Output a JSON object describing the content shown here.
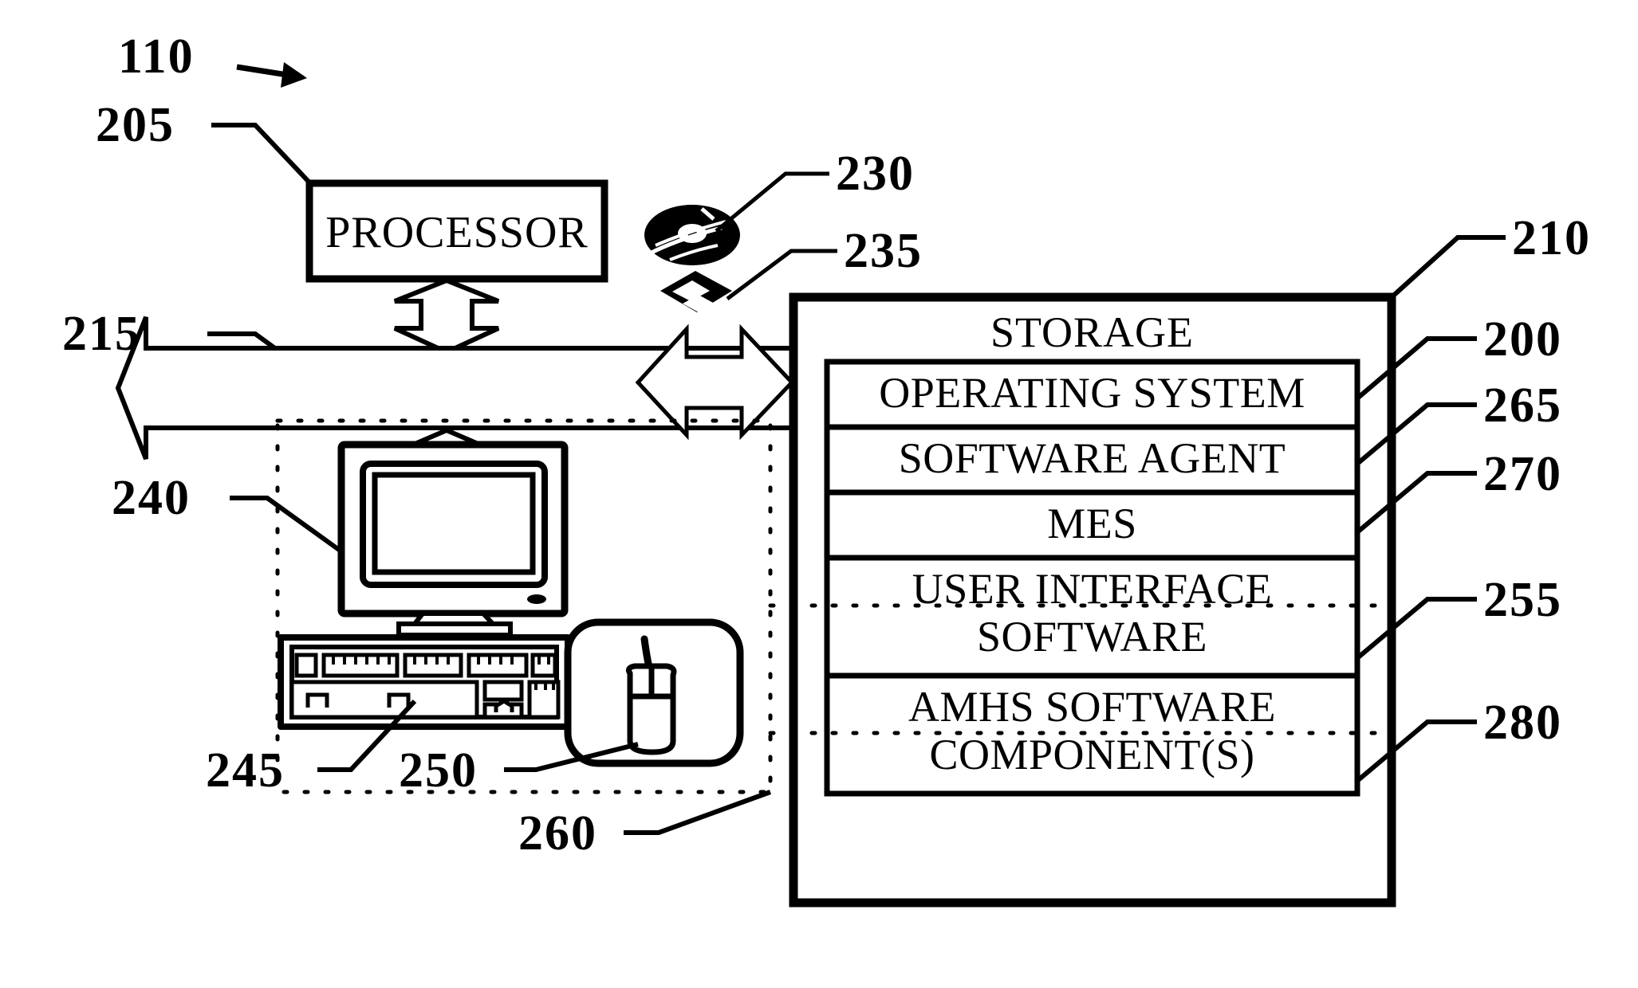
{
  "figure": {
    "title": "Computer system block diagram",
    "system_ref": "110"
  },
  "blocks": {
    "processor": {
      "label": "PROCESSOR",
      "ref": "205"
    },
    "bus": {
      "ref": "215"
    },
    "storage": {
      "label": "STORAGE",
      "ref": "210"
    },
    "monitor": {
      "ref": "240"
    },
    "keyboard": {
      "ref": "245"
    },
    "mouse": {
      "ref": "250"
    },
    "user_interface_group": {
      "ref": "260"
    },
    "optical_disc": {
      "ref": "230"
    },
    "floppy_disk": {
      "ref": "235"
    }
  },
  "storage_slots": [
    {
      "label": "OPERATING SYSTEM",
      "ref": "200"
    },
    {
      "label": "SOFTWARE AGENT",
      "ref": "265"
    },
    {
      "label": "MES",
      "ref": "270"
    },
    {
      "label": "USER INTERFACE SOFTWARE",
      "line1": "USER INTERFACE",
      "line2": "SOFTWARE",
      "ref": "255"
    },
    {
      "label": "AMHS SOFTWARE COMPONENT(S)",
      "line1": "AMHS SOFTWARE",
      "line2": "COMPONENT(S)",
      "ref": "280"
    }
  ],
  "icons": {
    "optical_disc": "optical-disc-icon",
    "floppy_disk": "floppy-disk-icon",
    "monitor": "crt-monitor-icon",
    "keyboard": "keyboard-icon",
    "mouse": "computer-mouse-icon",
    "system_arrow": "system-pointer-arrow-icon"
  },
  "colors": {
    "ink": "#000000",
    "paper": "#ffffff"
  }
}
